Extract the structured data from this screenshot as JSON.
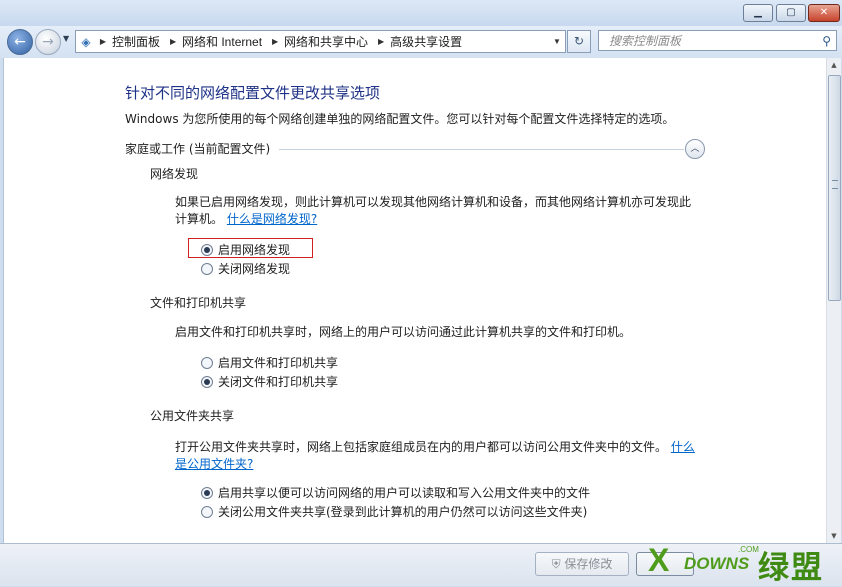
{
  "window": {
    "minimize_icon": "minimize-icon",
    "maximize_icon": "maximize-icon",
    "close_icon": "close-icon"
  },
  "nav": {
    "back_glyph": "←",
    "forward_glyph": "→",
    "breadcrumbs": [
      "控制面板",
      "网络和 Internet",
      "网络和共享中心",
      "高级共享设置"
    ],
    "search_placeholder": "搜索控制面板"
  },
  "page": {
    "title": "针对不同的网络配置文件更改共享选项",
    "intro": "Windows 为您所使用的每个网络创建单独的网络配置文件。您可以针对每个配置文件选择特定的选项。",
    "profile_label": "家庭或工作 (当前配置文件)",
    "sections": {
      "discovery": {
        "title": "网络发现",
        "description": "如果已启用网络发现，则此计算机可以发现其他网络计算机和设备，而其他网络计算机亦可发现此计算机。",
        "link": "什么是网络发现?",
        "options": [
          "启用网络发现",
          "关闭网络发现"
        ],
        "selected": 0
      },
      "file_printer": {
        "title": "文件和打印机共享",
        "description": "启用文件和打印机共享时，网络上的用户可以访问通过此计算机共享的文件和打印机。",
        "options": [
          "启用文件和打印机共享",
          "关闭文件和打印机共享"
        ],
        "selected": 1
      },
      "public_folder": {
        "title": "公用文件夹共享",
        "description": "打开公用文件夹共享时，网络上包括家庭组成员在内的用户都可以访问公用文件夹中的文件。",
        "link": "什么是公用文件夹?",
        "options": [
          "启用共享以便可以访问网络的用户可以读取和写入公用文件夹中的文件",
          "关闭公用文件夹共享(登录到此计算机的用户仍然可以访问这些文件夹)"
        ],
        "selected": 0
      }
    },
    "cut_text": "……"
  },
  "footer": {
    "save_label": "保存修改",
    "shield_icon": "uac-shield-icon"
  },
  "watermark": {
    "downs": "DOWNS",
    "com": ".COM",
    "cn": "绿盟"
  },
  "colors": {
    "title_blue": "#1e3287",
    "link_blue": "#0066cc",
    "highlight_red": "#d02020"
  }
}
